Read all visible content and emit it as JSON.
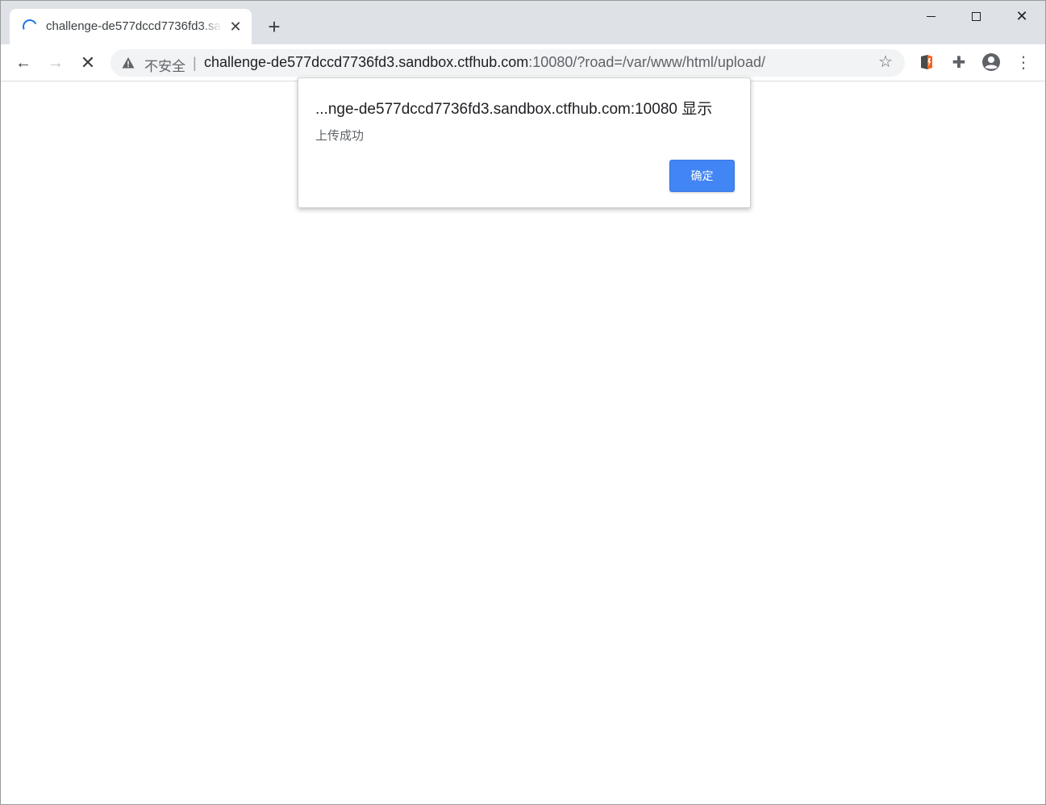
{
  "tab": {
    "title": "challenge-de577dccd7736fd3.sandbox.ctfhub.com",
    "close_glyph": "✕",
    "loading_icon": "spinner-icon"
  },
  "newtab_glyph": "+",
  "window_controls": {
    "minimize_icon": "minimize-icon",
    "maximize_icon": "maximize-icon",
    "close_glyph": "✕"
  },
  "toolbar": {
    "back_glyph": "←",
    "forward_glyph": "→",
    "stop_glyph": "✕",
    "security_label": "不安全",
    "separator": "|",
    "url_host": "challenge-de577dccd7736fd3.sandbox.ctfhub.com",
    "url_rest": ":10080/?road=/var/www/html/upload/",
    "bookmark_glyph": "☆",
    "extensions_glyph": "✚",
    "menu_glyph": "⋮"
  },
  "dialog": {
    "title": "...nge-de577dccd7736fd3.sandbox.ctfhub.com:10080 显示",
    "message": "上传成功",
    "ok_label": "确定"
  },
  "colors": {
    "accent": "#4285f4",
    "tabstrip": "#dee1e6",
    "omnibox": "#f1f3f4"
  }
}
